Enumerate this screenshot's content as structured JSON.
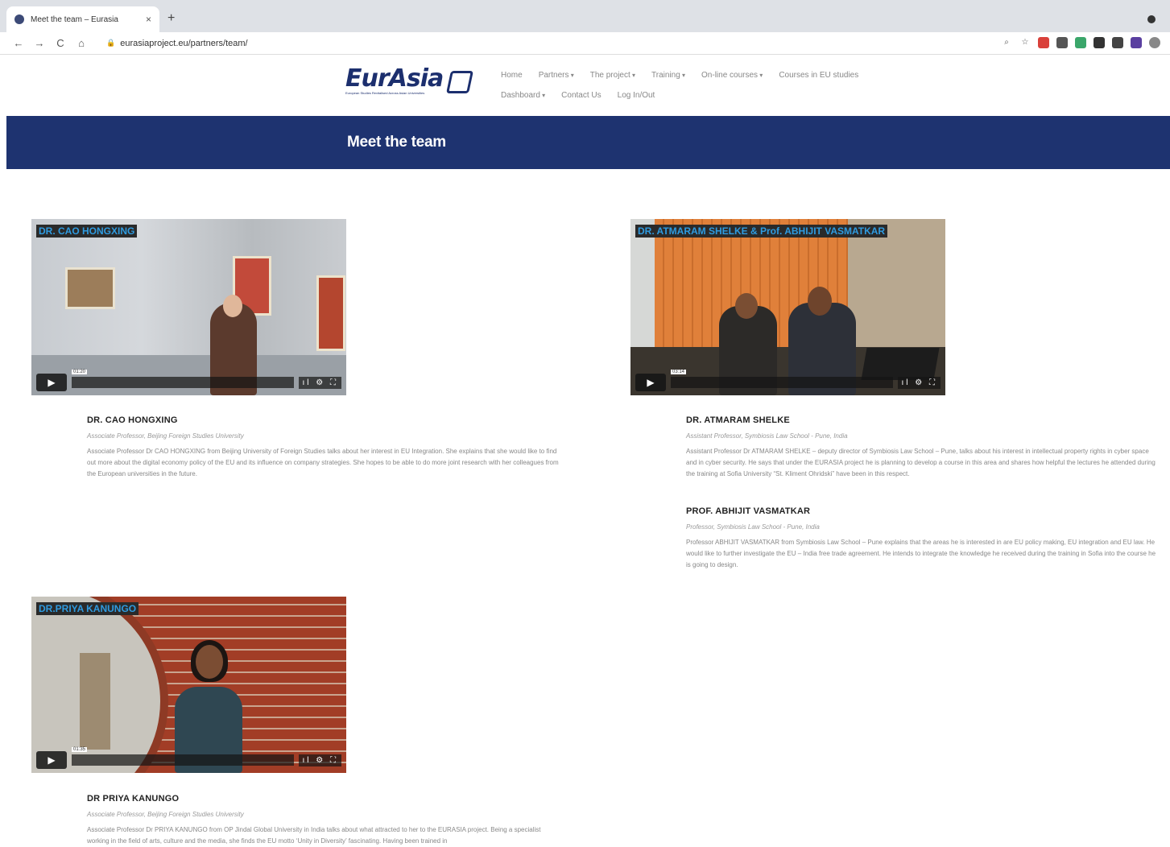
{
  "browser": {
    "tab_title": "Meet the team – Eurasia",
    "tab_close": "×",
    "new_tab": "+",
    "url": "eurasiaproject.eu/partners/team/",
    "nav": {
      "back": "←",
      "forward": "→",
      "reload": "C",
      "home": "⌂"
    }
  },
  "site": {
    "logo_text": "EurAsia",
    "logo_subtitle": "European Studies Revitalised Across Asian Universities",
    "menu_row1": [
      "Home",
      "Partners",
      "The project",
      "Training",
      "On-line courses",
      "Courses in EU studies"
    ],
    "menu_row2": [
      "Dashboard",
      "Contact Us",
      "Log In/Out"
    ]
  },
  "banner": {
    "title": "Meet the team"
  },
  "videos": [
    {
      "overlay": "DR. CAO HONGXING",
      "time": "01:20"
    },
    {
      "overlay": "DR. ATMARAM SHELKE & Prof. ABHIJIT VASMATKAR",
      "time": "03:14"
    },
    {
      "overlay": "DR.PRIYA KANUNGO",
      "time": "01:35"
    }
  ],
  "bios": [
    {
      "name": "DR. CAO HONGXING",
      "role": "Associate Professor, Beijing Foreign Studies University",
      "text": "Associate Professor Dr CAO HONGXING from Beijing University of Foreign Studies talks about her interest in EU Integration. She explains that she would like to find out more about the digital economy policy of the EU and its influence on company strategies. She hopes to be able to do more joint research with her colleagues from the European universities in the future."
    },
    {
      "name": "DR. ATMARAM SHELKE",
      "role": "Assistant Professor, Symbiosis Law School - Pune, India",
      "text": "Assistant Professor Dr ATMARAM SHELKE – deputy director of Symbiosis Law School – Pune, talks about his interest in intellectual property rights in cyber space and in cyber security. He says that under the EURASIA project he is planning to develop a course in this area and shares how helpful the lectures he attended during the training at Sofia University “St. Kliment Ohridski” have been in this respect."
    },
    {
      "name": "PROF. ABHIJIT VASMATKAR",
      "role": "Professor, Symbiosis Law School - Pune, India",
      "text": "Professor ABHIJIT VASMATKAR from Symbiosis Law School – Pune explains that the areas he is interested in are EU policy making, EU integration and EU law. He would like to further investigate the EU – India free trade agreement. He intends to integrate the knowledge he received during the training in Sofia into the course he is going to design."
    },
    {
      "name": "DR PRIYA KANUNGO",
      "role": "Associate Professor, Beijing Foreign Studies University",
      "text": "Associate Professor Dr PRIYA KANUNGO from OP Jindal Global University in India talks about what attracted to her to the EURASIA project. Being a specialist working in the field of arts, culture and the media, she finds the EU motto ‘Unity in Diversity’ fascinating. Having been trained in"
    }
  ]
}
